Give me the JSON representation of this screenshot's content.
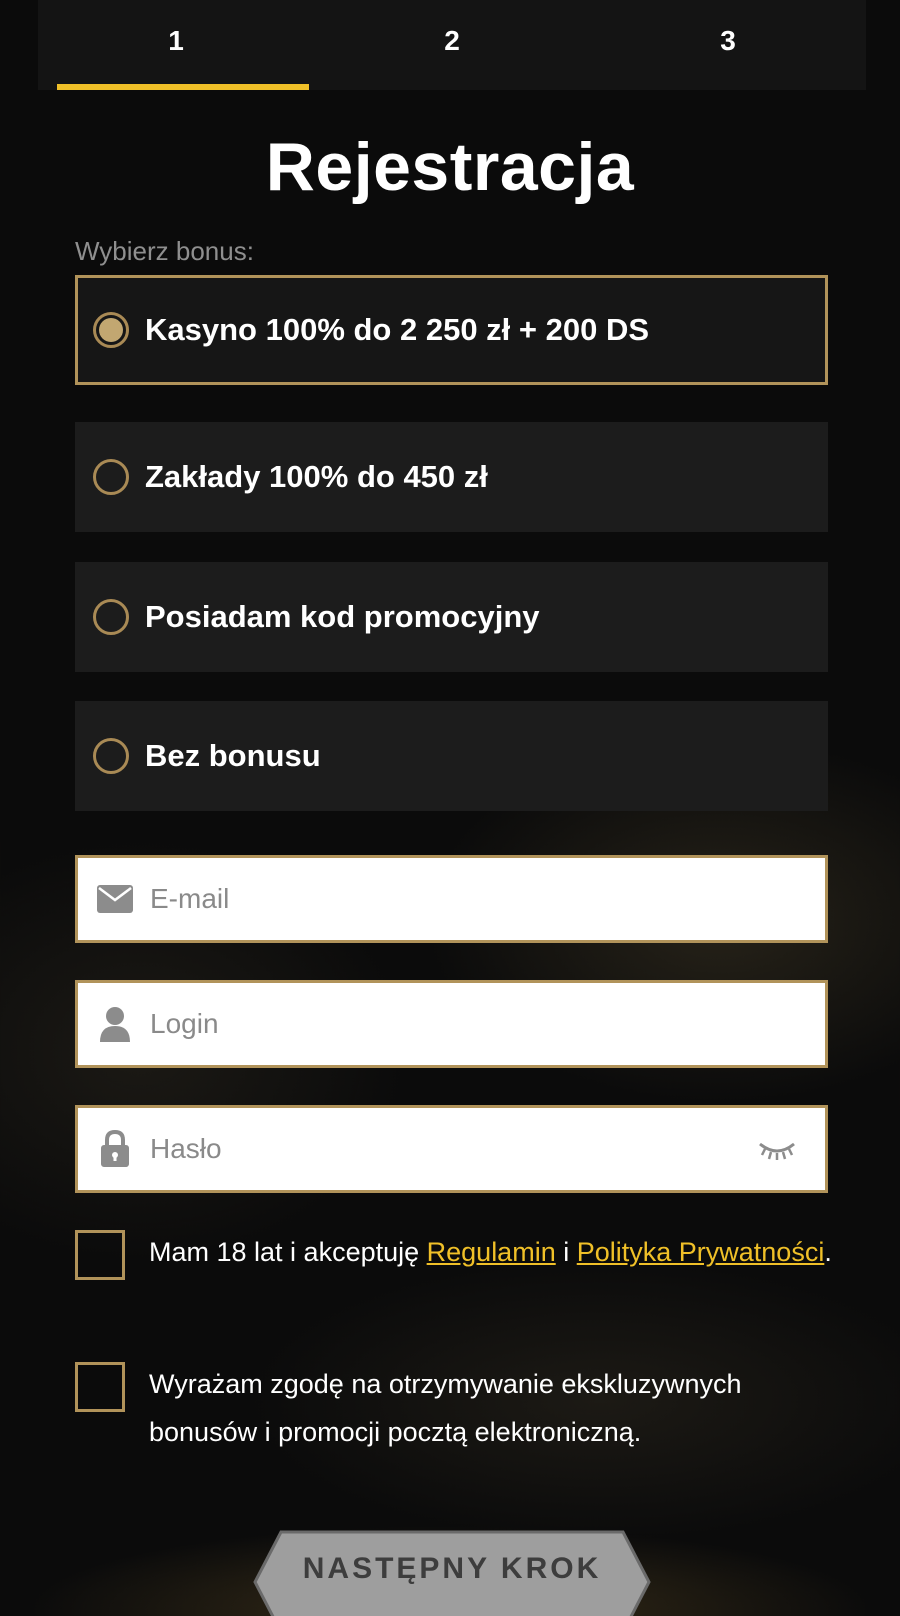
{
  "steps": [
    {
      "label": "1",
      "active": true
    },
    {
      "label": "2",
      "active": false
    },
    {
      "label": "3",
      "active": false
    }
  ],
  "title": "Rejestracja",
  "bonus": {
    "label": "Wybierz bonus:",
    "options": [
      {
        "label": "Kasyno 100% do 2 250 zł + 200 DS",
        "selected": true
      },
      {
        "label": "Zakłady 100% do 450 zł",
        "selected": false
      },
      {
        "label": "Posiadam kod promocyjny",
        "selected": false
      },
      {
        "label": "Bez bonusu",
        "selected": false
      }
    ]
  },
  "fields": {
    "email": {
      "placeholder": "E-mail",
      "value": "",
      "icon": "envelope-icon"
    },
    "login": {
      "placeholder": "Login",
      "value": "",
      "icon": "user-icon"
    },
    "password": {
      "placeholder": "Hasło",
      "value": "",
      "icon": "lock-icon",
      "toggle_icon": "eye-closed-icon"
    }
  },
  "consents": {
    "terms": {
      "text_before": "Mam 18 lat i akceptuję ",
      "link1": "Regulamin",
      "text_between": " i ",
      "link2": "Polityka Prywatności",
      "text_after": ".",
      "checked": false
    },
    "marketing": {
      "text": "Wyrażam zgodę na otrzymywanie ekskluzywnych bonusów i promocji pocztą elektroniczną.",
      "checked": false
    }
  },
  "next_button": {
    "label": "NASTĘPNY KROK"
  },
  "colors": {
    "accent_gold": "#f0c028",
    "border_gold": "#b1935a",
    "background": "#0b0b0b",
    "option_bg": "#1c1c1c"
  }
}
